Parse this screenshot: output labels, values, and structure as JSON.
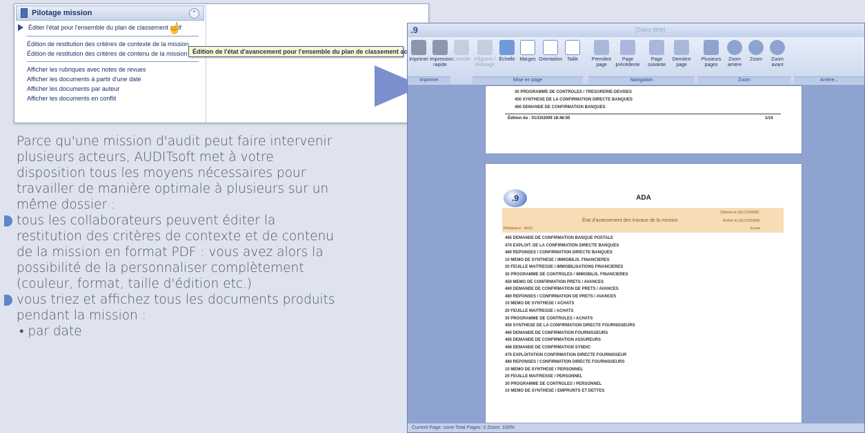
{
  "mission_panel": {
    "title": "Pilotage mission",
    "collapse_glyph": "⌃",
    "items_group1": [
      "Éditer l'état pour l'ensemble du plan de classement actif"
    ],
    "items_group2": [
      "Édition de restitution des critères de contexte de la mission",
      "Édition de restitution des critères de contenu de la mission"
    ],
    "items_group3": [
      "Afficher les rubriques avec notes de revues",
      "Afficher les documents à partir d'une date",
      "Afficher les documents par auteur",
      "Afficher les documents en conflit"
    ],
    "tooltip": "Édition de l'état d'avancement pour l'ensemble du plan de classement actif",
    "hand_glyph": "☝"
  },
  "marketing": {
    "intro": "Parce qu'une mission d'audit peut faire intervenir plusieurs acteurs, AUDITsoft met à votre disposition tous les moyens nécessaires pour travailler de manière optimale à plusieurs sur un même dossier :",
    "bullet1": "tous les collaborateurs peuvent éditer la restitution des critères de contexte et de contenu de la mission en format PDF : vous avez alors la possibilité de la personnaliser complètement (couleur, format, taille d'édition etc.)",
    "bullet2": "vous triez et affichez tous les documents produits pendant la mission :",
    "sub_bullet1": "• par date"
  },
  "app": {
    "logo": ".9",
    "window_title": "[Sans titre]",
    "ribbon": {
      "buttons": [
        {
          "label": "Imprimer",
          "icon": "printer-icon"
        },
        {
          "label": "Impression rapide",
          "icon": "quick-print-icon"
        },
        {
          "label": "Contrôle",
          "icon": "control-icon",
          "disabled": true
        },
        {
          "label": "Filigrane / Message",
          "icon": "watermark-icon",
          "disabled": true
        },
        {
          "label": "Échelle",
          "icon": "scale-icon"
        },
        {
          "label": "Marges",
          "icon": "margins-icon"
        },
        {
          "label": "Orientation",
          "icon": "orientation-icon"
        },
        {
          "label": "Taille",
          "icon": "size-icon"
        },
        {
          "label": "Première page",
          "icon": "first-page-icon"
        },
        {
          "label": "Page précédente",
          "icon": "previous-page-icon"
        },
        {
          "label": "Page suivante",
          "icon": "next-page-icon"
        },
        {
          "label": "Dernière page",
          "icon": "last-page-icon"
        },
        {
          "label": "Plusieurs pages",
          "icon": "multi-page-icon"
        },
        {
          "label": "Zoom arrière",
          "icon": "zoom-out-icon"
        },
        {
          "label": "Zoom",
          "icon": "zoom-icon"
        },
        {
          "label": "Zoom avant",
          "icon": "zoom-in-icon"
        }
      ],
      "groups": [
        "Imprimer",
        "Mise en page",
        "Navigation",
        "Zoom",
        "Arrière..."
      ]
    },
    "status_text": "Current Page: none    Total Pages: 0    Zoom: 100%",
    "accent_color": "#8fa3d1"
  },
  "page1": {
    "lines": [
      "30 PROGRAMME DE CONTROLES / TRESORERIE-DEVISES",
      "450 SYNTHESE DE LA CONFIRMATION DIRECTE BANQUES",
      "460 DEMANDE DE CONFIRMATION BANQUES"
    ],
    "edition": "Édition du : 01/10/2009 18:46:55",
    "page_number": "1/15"
  },
  "page2": {
    "logo": ".9",
    "title": "ADA",
    "cloture": "Clôture le (31/12/2008)",
    "arrete": "Arrêté le (31/12/2008)",
    "etat": "État d'avancement des travaux de la mission",
    "redacteur": "Rédacteur : AGO",
    "euros": "Euros",
    "lines": [
      "465 DEMANDE DE CONFIRMATION BANQUE POSTALE",
      "470 EXPLOIT. DE LA CONFIRMATION DIRECTE BANQUES",
      "480 REPONSES / CONFIRMATION DIRECTE BANQUES",
      "10 MEMO DE SYNTHESE / IMMOBILIS. FINANCIERES",
      "20 FEUILLE MAITRESSE / IMMOBILISATIONS FINANCIERES",
      "30 PROGRAMME DE CONTROLES / IMMOBILIS. FINANCIERES",
      "450 MEMO DE CONFIRMATION PRETS / AVANCES",
      "460 DEMANDE DE CONFIRMATION DE PRETS / AVANCES",
      "480 REPONSES / CONFIRMATION DE PRETS / AVANCES",
      "10 MEMO DE SYNTHESE / ACHATS",
      "20 FEUILLE MAITRESSE / ACHATS",
      "30 PROGRAMME DE CONTROLES / ACHATS",
      "450 SYNTHESE DE LA CONFIRMATION DIRECTE FOURNISSEURS",
      "460 DEMANDE DE CONFIRMATION FOURNISSEURS",
      "465 DEMANDE DE CONFIRMATION ASSUREURS",
      "468 DEMANDE DE CONFIRMATION SYNDIC",
      "470 EXPLOITATION CONFIRMATION DIRECTE FOURNISSEUR",
      "480 REPONSES / CONFIRMATION DIRECTE FOURNISSEURS",
      "10 MEMO DE SYNTHESE / PERSONNEL",
      "20 FEUILLE MAITRESSE / PERSONNEL",
      "30 PROGRAMME DE CONTROLES / PERSONNEL",
      "10 MEMO DE SYNTHESE / EMPRUNTS ET DETTES"
    ]
  }
}
